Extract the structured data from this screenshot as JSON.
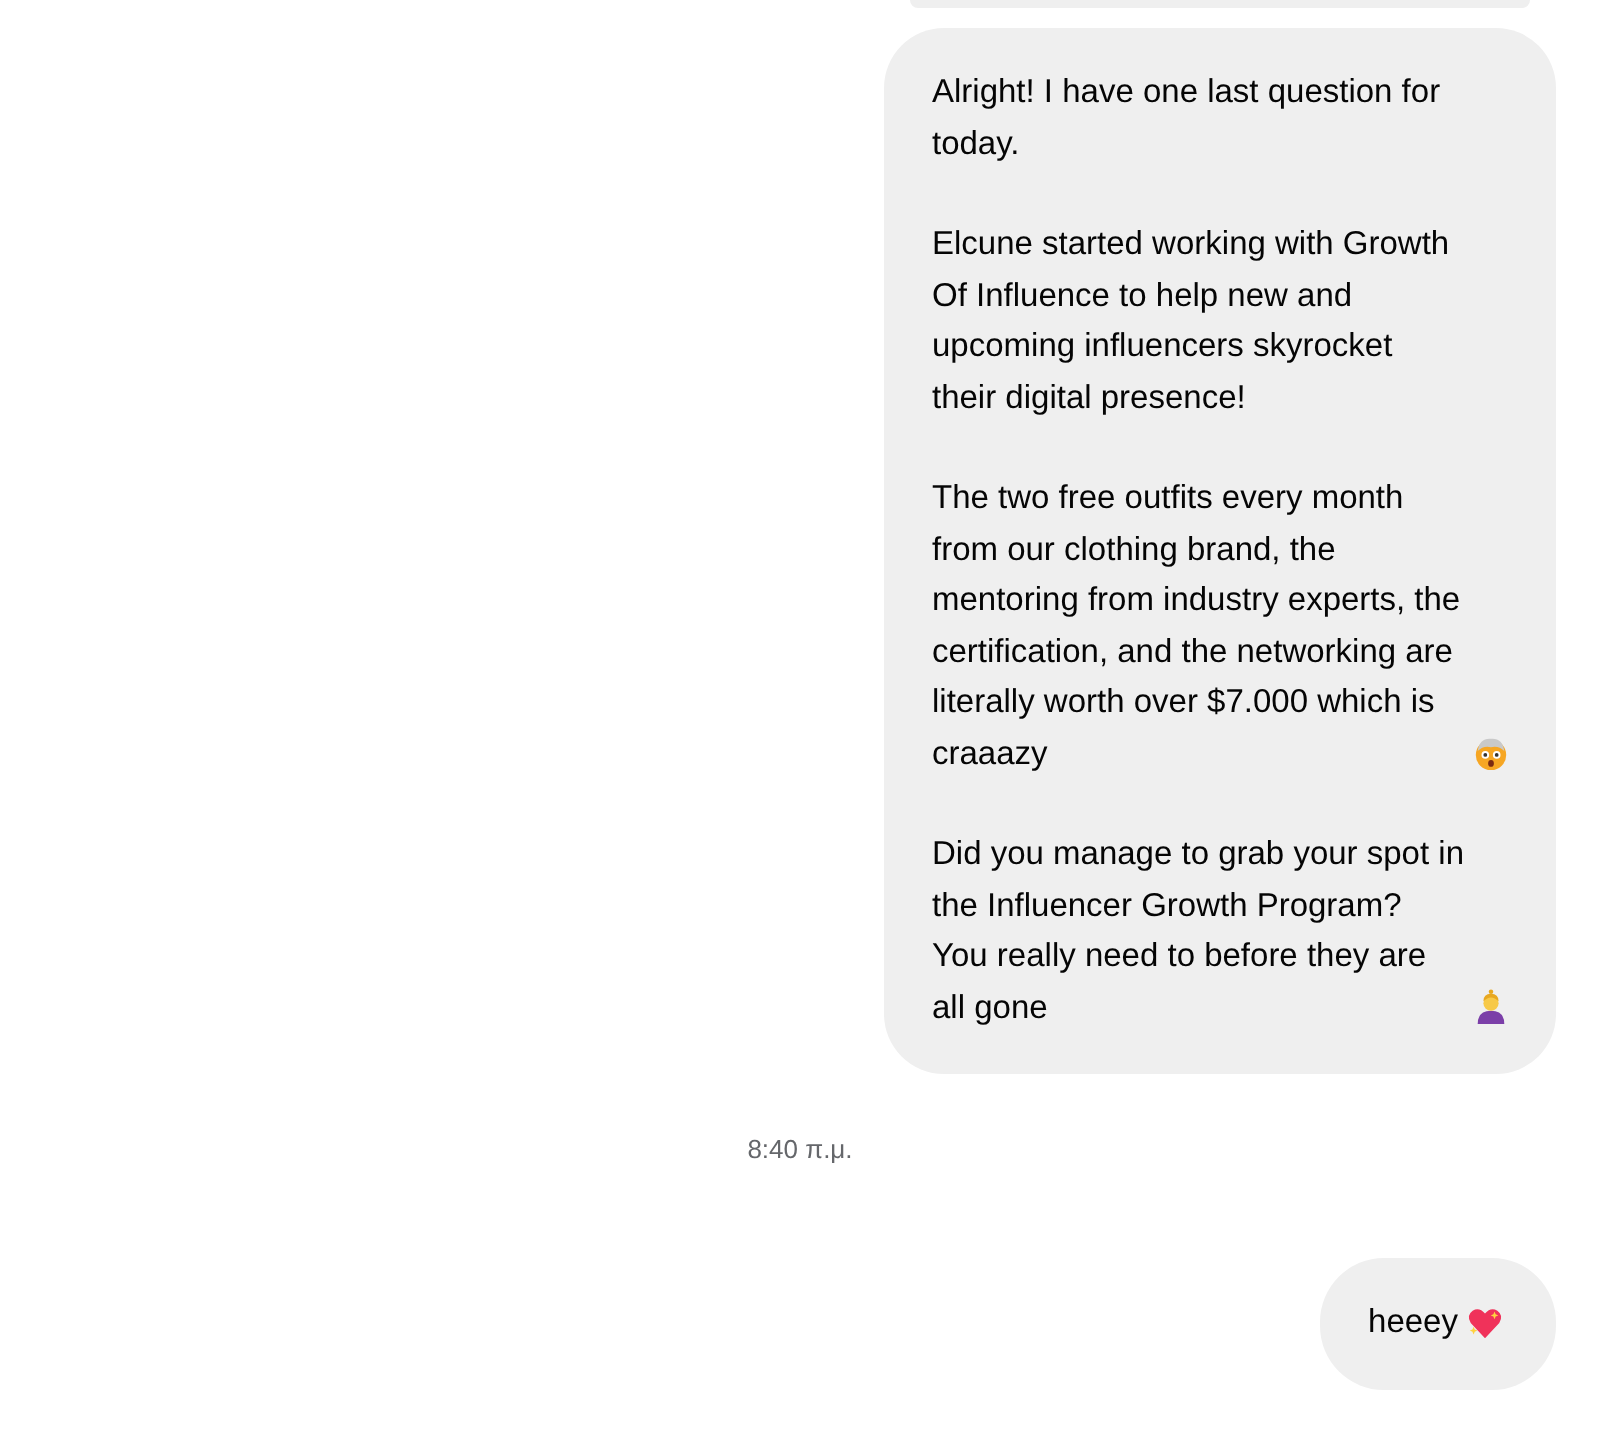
{
  "messages": [
    {
      "kind": "clipped_bubble"
    },
    {
      "kind": "bubble",
      "paragraphs": [
        {
          "kind": "plain",
          "text": "Alright! I have one last question for today."
        },
        {
          "kind": "plain",
          "text": "Elcune started working with Growth Of Influence to help new and upcoming influencers skyrocket their digital presence!"
        },
        {
          "kind": "with_emoji",
          "text": "The two free outfits every month from our clothing brand, the mentoring from industry experts, the certification, and the networking are literally worth over $7.000 which is craaazy"
        },
        {
          "kind": "with_emoji",
          "text": "Did you manage to grab your spot in the Influencer Growth Program? You really need to before they are all gone"
        }
      ]
    },
    {
      "kind": "timestamp",
      "text": "8:40 π.μ."
    },
    {
      "kind": "bubble",
      "paragraphs": [
        {
          "kind": "with_emoji",
          "text": "heeey"
        }
      ]
    }
  ]
}
